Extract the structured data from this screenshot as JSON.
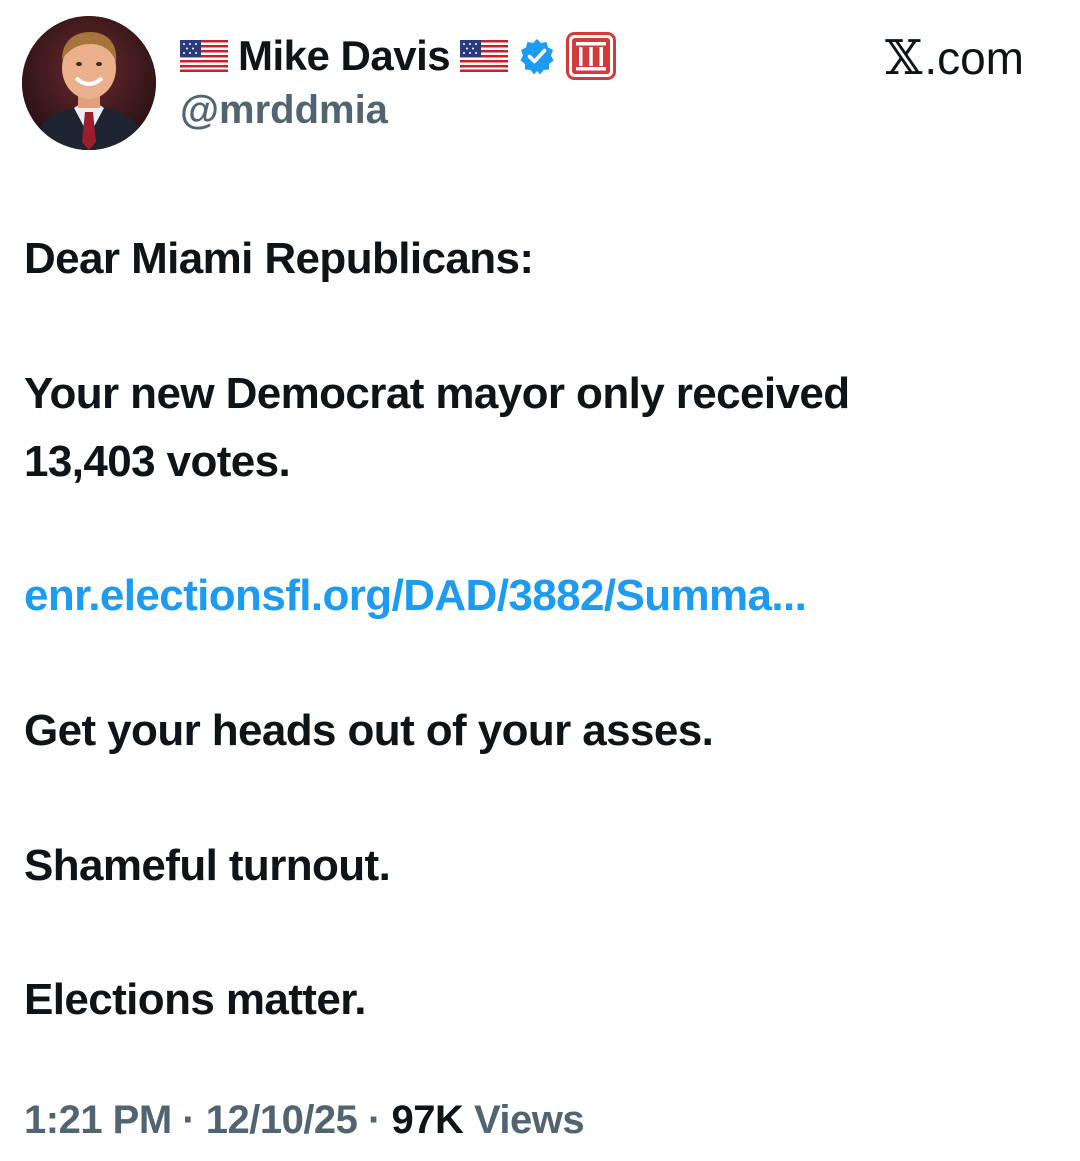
{
  "header": {
    "display_name": "Mike Davis",
    "handle": "@mrddmia",
    "site_label": ".com",
    "site_logo_glyph": "𝕏",
    "icons": {
      "flag_left": "us-flag-icon",
      "flag_right": "us-flag-icon",
      "verified": "verified-badge-icon",
      "affiliate": "affiliate-badge-icon"
    },
    "colors": {
      "verified_blue": "#1d9bf0",
      "affiliate_red": "#d33a3a"
    }
  },
  "tweet": {
    "paragraphs": {
      "salutation": "Dear Miami Republicans:",
      "line1": "Your new Democrat mayor only received",
      "line2": "13,403 votes.",
      "link": "enr.electionsfl.org/DAD/3882/Summa...",
      "p3": "Get your heads out of your asses.",
      "p4": "Shameful turnout.",
      "p5": "Elections matter."
    },
    "link_color": "#1d9bf0"
  },
  "meta": {
    "time": "1:21 PM",
    "sep1": " · ",
    "date": "12/10/25",
    "sep2": " · ",
    "views_count": "97K",
    "views_label": " Views"
  }
}
